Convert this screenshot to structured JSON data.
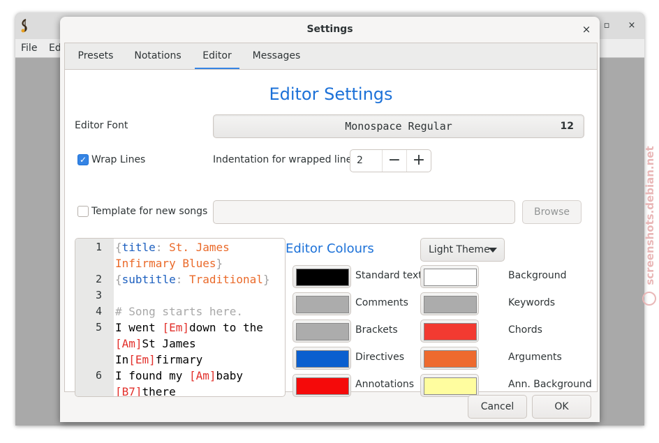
{
  "main_window": {
    "menus": [
      "File",
      "Ed"
    ]
  },
  "dialog": {
    "title": "Settings",
    "close_glyph": "×",
    "tabs": [
      {
        "label": "Presets"
      },
      {
        "label": "Notations"
      },
      {
        "label": "Editor",
        "active": true
      },
      {
        "label": "Messages"
      }
    ]
  },
  "editor_settings": {
    "heading": "Editor Settings",
    "font_label": "Editor Font",
    "font_name": "Monospace Regular",
    "font_size": "12",
    "wrap_lines_label": "Wrap Lines",
    "wrap_lines_checked": true,
    "indent_label": "Indentation for wrapped lines",
    "indent_value": "2",
    "minus_glyph": "−",
    "plus_glyph": "+",
    "template_label": "Template for new songs",
    "template_checked": false,
    "template_value": "",
    "browse_label": "Browse"
  },
  "preview": {
    "lines": [
      {
        "num": "1",
        "parts": [
          [
            "br",
            "{"
          ],
          [
            "dir",
            "title"
          ],
          [
            "br",
            ":"
          ],
          [
            "arg",
            " St. James"
          ]
        ]
      },
      {
        "num": "",
        "parts": [
          [
            "arg",
            " Infirmary Blues"
          ],
          [
            "br",
            "}"
          ]
        ],
        "indent": true
      },
      {
        "num": "2",
        "parts": [
          [
            "br",
            "{"
          ],
          [
            "dir",
            "subtitle"
          ],
          [
            "br",
            ":"
          ],
          [
            "arg",
            " Traditional"
          ],
          [
            "br",
            "}"
          ]
        ]
      },
      {
        "num": "3",
        "parts": []
      },
      {
        "num": "4",
        "parts": [
          [
            "cm",
            "# Song starts here."
          ]
        ]
      },
      {
        "num": "5",
        "parts": [
          [
            "tx",
            "I went "
          ],
          [
            "ch",
            "[Em]"
          ],
          [
            "tx",
            "down to the"
          ]
        ]
      },
      {
        "num": "",
        "parts": [
          [
            "ch",
            " [Am]"
          ],
          [
            "tx",
            "St James"
          ]
        ],
        "indent": true
      },
      {
        "num": "",
        "parts": [
          [
            "tx",
            " In"
          ],
          [
            "ch",
            "[Em]"
          ],
          [
            "tx",
            "firmary"
          ]
        ],
        "indent": true
      },
      {
        "num": "6",
        "parts": [
          [
            "tx",
            "I found my "
          ],
          [
            "ch",
            "[Am]"
          ],
          [
            "tx",
            "baby"
          ]
        ]
      },
      {
        "num": "",
        "parts": [
          [
            "ch",
            " [B7]"
          ],
          [
            "tx",
            "there"
          ]
        ],
        "indent": true
      }
    ]
  },
  "colours": {
    "heading": "Editor Colours",
    "theme_label": "Light Theme",
    "left": [
      {
        "label": "Standard text",
        "color": "#000000"
      },
      {
        "label": "Comments",
        "color": "#acacac"
      },
      {
        "label": "Brackets",
        "color": "#acacac"
      },
      {
        "label": "Directives",
        "color": "#0a5fcf"
      },
      {
        "label": "Annotations",
        "color": "#f50a0a"
      }
    ],
    "right": [
      {
        "label": "Background",
        "color": "#ffffff"
      },
      {
        "label": "Keywords",
        "color": "#acacac"
      },
      {
        "label": "Chords",
        "color": "#f23a31"
      },
      {
        "label": "Arguments",
        "color": "#ee6a2e"
      },
      {
        "label": "Ann. Background",
        "color": "#fffd9f"
      }
    ]
  },
  "actions": {
    "cancel": "Cancel",
    "ok": "OK"
  },
  "watermark": "screenshots.debian.net"
}
